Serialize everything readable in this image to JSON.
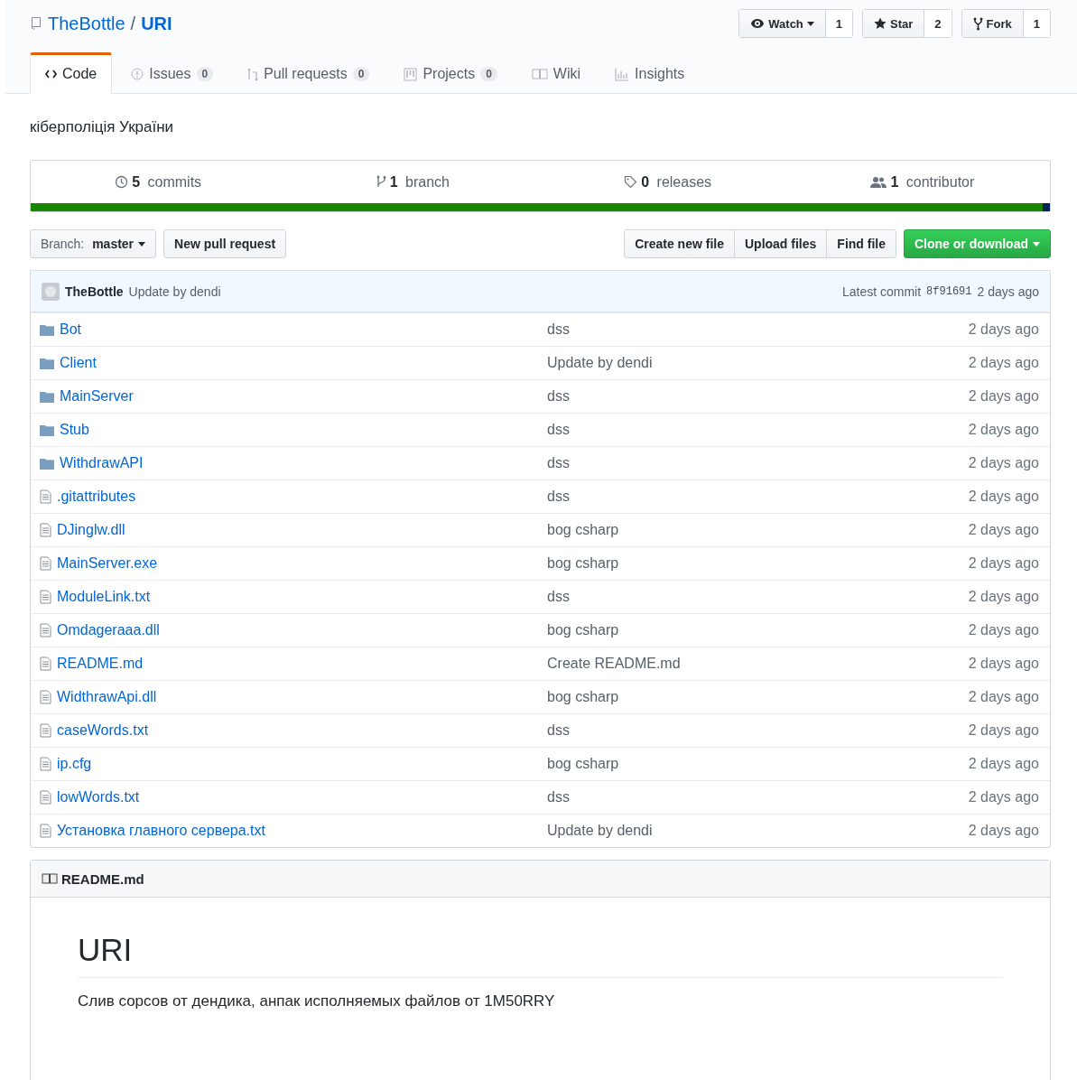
{
  "repo": {
    "owner": "TheBottle",
    "separator": "/",
    "name": "URI"
  },
  "actions": [
    {
      "label": "Watch",
      "kind": "watch",
      "count": "1",
      "dropdown": true
    },
    {
      "label": "Star",
      "kind": "star",
      "count": "2",
      "dropdown": false
    },
    {
      "label": "Fork",
      "kind": "fork",
      "count": "1",
      "dropdown": false
    }
  ],
  "tabs": [
    {
      "label": "Code",
      "kind": "code",
      "selected": true
    },
    {
      "label": "Issues",
      "kind": "issues",
      "counter": "0",
      "selected": false
    },
    {
      "label": "Pull requests",
      "kind": "pulls",
      "counter": "0",
      "selected": false
    },
    {
      "label": "Projects",
      "kind": "projects",
      "counter": "0",
      "selected": false
    },
    {
      "label": "Wiki",
      "kind": "wiki",
      "selected": false
    },
    {
      "label": "Insights",
      "kind": "insights",
      "selected": false
    }
  ],
  "description": "кіберполіція України",
  "summary": [
    {
      "kind": "commits",
      "count": "5",
      "label": "commits"
    },
    {
      "kind": "branch",
      "count": "1",
      "label": "branch"
    },
    {
      "kind": "releases",
      "count": "0",
      "label": "releases"
    },
    {
      "kind": "contributor",
      "count": "1",
      "label": "contributor"
    }
  ],
  "branch_button": {
    "prefix": "Branch:",
    "value": "master"
  },
  "new_pr_button": "New pull request",
  "file_buttons": [
    "Create new file",
    "Upload files",
    "Find file"
  ],
  "clone_button": "Clone or download",
  "commit_bar": {
    "author": "TheBottle",
    "message": "Update by dendi",
    "latest_label": "Latest commit",
    "sha": "8f91691",
    "age": "2 days ago"
  },
  "files": [
    {
      "kind": "dir",
      "name": "Bot",
      "message": "dss",
      "age": "2 days ago"
    },
    {
      "kind": "dir",
      "name": "Client",
      "message": "Update by dendi",
      "age": "2 days ago"
    },
    {
      "kind": "dir",
      "name": "MainServer",
      "message": "dss",
      "age": "2 days ago"
    },
    {
      "kind": "dir",
      "name": "Stub",
      "message": "dss",
      "age": "2 days ago"
    },
    {
      "kind": "dir",
      "name": "WithdrawAPI",
      "message": "dss",
      "age": "2 days ago"
    },
    {
      "kind": "file",
      "name": ".gitattributes",
      "message": "dss",
      "age": "2 days ago"
    },
    {
      "kind": "file",
      "name": "DJinglw.dll",
      "message": "bog csharp",
      "age": "2 days ago"
    },
    {
      "kind": "file",
      "name": "MainServer.exe",
      "message": "bog csharp",
      "age": "2 days ago"
    },
    {
      "kind": "file",
      "name": "ModuleLink.txt",
      "message": "dss",
      "age": "2 days ago"
    },
    {
      "kind": "file",
      "name": "Omdageraaa.dll",
      "message": "bog csharp",
      "age": "2 days ago"
    },
    {
      "kind": "file",
      "name": "README.md",
      "message": "Create README.md",
      "age": "2 days ago"
    },
    {
      "kind": "file",
      "name": "WidthrawApi.dll",
      "message": "bog csharp",
      "age": "2 days ago"
    },
    {
      "kind": "file",
      "name": "caseWords.txt",
      "message": "dss",
      "age": "2 days ago"
    },
    {
      "kind": "file",
      "name": "ip.cfg",
      "message": "bog csharp",
      "age": "2 days ago"
    },
    {
      "kind": "file",
      "name": "lowWords.txt",
      "message": "dss",
      "age": "2 days ago"
    },
    {
      "kind": "file",
      "name": "Установка главного сервера.txt",
      "message": "Update by dendi",
      "age": "2 days ago"
    }
  ],
  "readme": {
    "filename": "README.md",
    "heading": "URI",
    "text": "Слив сорсов от дендика, анпак исполняемых файлов от 1M50RRY"
  }
}
